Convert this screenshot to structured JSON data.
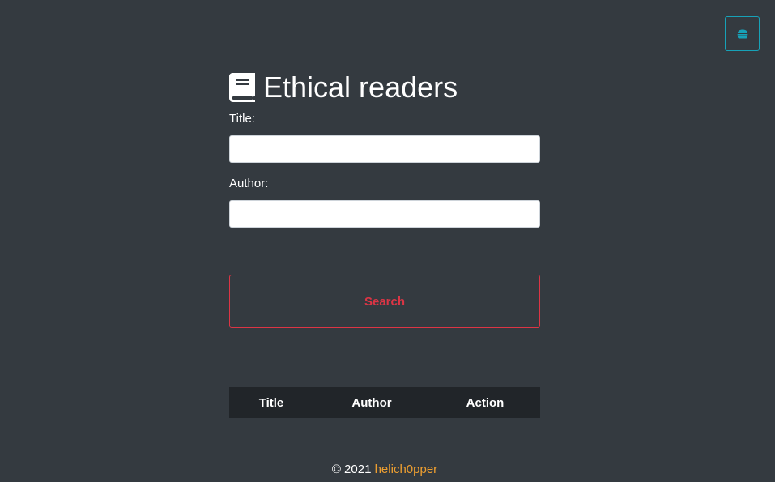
{
  "header": {
    "menu_icon": "hamburger-icon",
    "menu_icon_color": "#17a2b8"
  },
  "main": {
    "icon": "book-icon",
    "title": "Ethical readers",
    "fields": {
      "title_label": "Title:",
      "title_value": "",
      "author_label": "Author:",
      "author_value": ""
    },
    "search_button": {
      "label": "Search",
      "color": "#dc3545"
    },
    "table": {
      "columns": [
        "Title",
        "Author",
        "Action"
      ],
      "rows": []
    }
  },
  "footer": {
    "copyright": "© 2021",
    "author": "helich0pper",
    "author_color": "#f0a030"
  },
  "colors": {
    "background": "#343a40",
    "table_header": "#212529"
  }
}
